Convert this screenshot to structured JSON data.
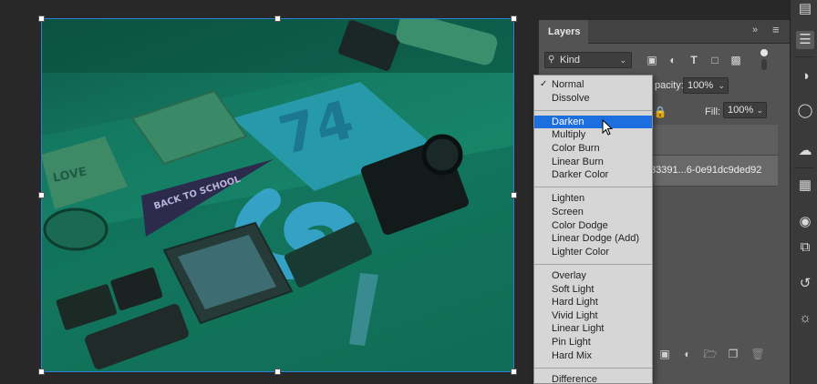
{
  "panel": {
    "tab_title": "Layers",
    "collapse_glyph": "»",
    "menu_glyph": "≡",
    "filter_kind": "Kind",
    "filter_icons": [
      "image-filter-icon",
      "adjustment-filter-icon",
      "type-filter-icon",
      "shape-filter-icon",
      "smart-object-filter-icon"
    ],
    "opacity_label": "pacity:",
    "opacity_value": "100%",
    "fill_label": "Fill:",
    "fill_value": "100%",
    "layer_name_partial": "33391...6-0e91dc9ded92",
    "footer_icons": [
      "mask-icon",
      "adjustment-layer-icon",
      "group-folder-icon",
      "new-layer-icon",
      "trash-icon"
    ]
  },
  "blend_menu": {
    "checked": "Normal",
    "highlighted": "Darken",
    "groups": [
      [
        "Normal",
        "Dissolve"
      ],
      [
        "Darken",
        "Multiply",
        "Color Burn",
        "Linear Burn",
        "Darker Color"
      ],
      [
        "Lighten",
        "Screen",
        "Color Dodge",
        "Linear Dodge (Add)",
        "Lighter Color"
      ],
      [
        "Overlay",
        "Soft Light",
        "Hard Light",
        "Vivid Light",
        "Linear Light",
        "Pin Light",
        "Hard Mix"
      ],
      [
        "Difference"
      ]
    ]
  },
  "canvas": {
    "pennant_text": "BACK TO SCHOOL",
    "tint_color": "#137a61"
  },
  "colors": {
    "selection": "#1d6fe0",
    "bounding_box": "#2f7fd6"
  },
  "toolbar_icons": [
    "info-icon",
    "layers-icon",
    "adjustments-icon",
    "light-icon",
    "libraries-icon",
    "grid-icon",
    "channels-icon",
    "paths-icon",
    "history-icon",
    "swatches-icon"
  ]
}
